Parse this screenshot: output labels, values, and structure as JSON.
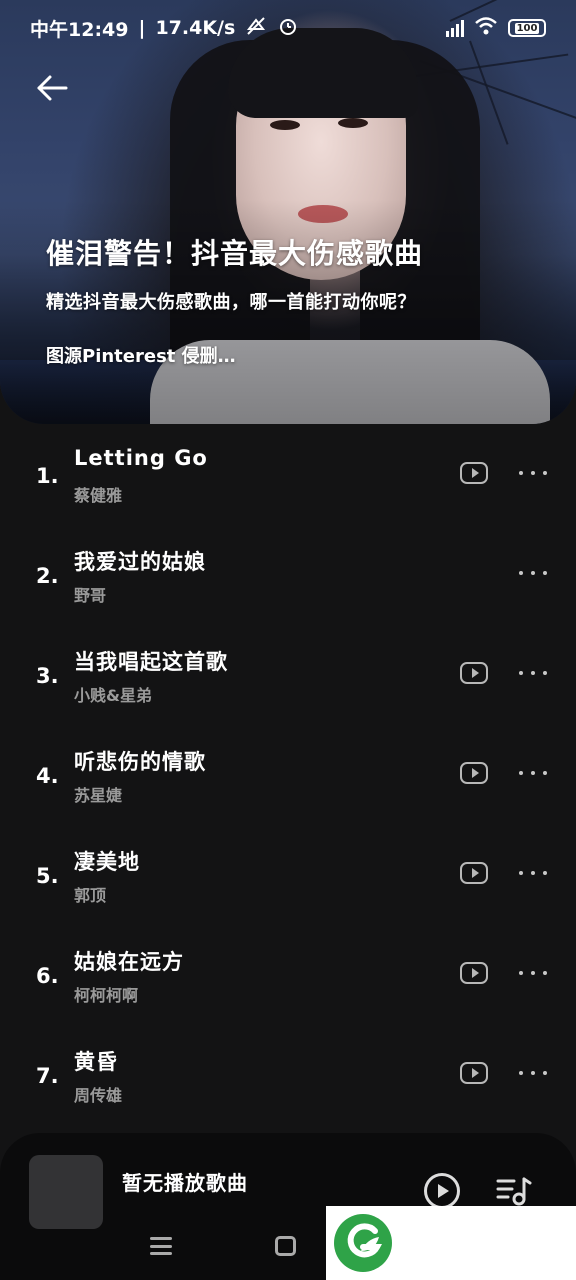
{
  "status_bar": {
    "time": "中午12:49",
    "speed": "17.4K/s",
    "battery": "100"
  },
  "header": {
    "title": "催泪警告！抖音最大伤感歌曲",
    "subtitle": "精选抖音最大伤感歌曲，哪一首能打动你呢？",
    "description": "图源Pinterest 侵删…"
  },
  "songs": [
    {
      "index": "1.",
      "title": "Letting Go",
      "artist": "蔡健雅",
      "has_video": true
    },
    {
      "index": "2.",
      "title": "我爱过的姑娘",
      "artist": "野哥",
      "has_video": false
    },
    {
      "index": "3.",
      "title": "当我唱起这首歌",
      "artist": "小贱&星弟",
      "has_video": true
    },
    {
      "index": "4.",
      "title": "听悲伤的情歌",
      "artist": "苏星婕",
      "has_video": true
    },
    {
      "index": "5.",
      "title": "凄美地",
      "artist": "郭顶",
      "has_video": true
    },
    {
      "index": "6.",
      "title": "姑娘在远方",
      "artist": "柯柯柯啊",
      "has_video": true
    },
    {
      "index": "7.",
      "title": "黄昏",
      "artist": "周传雄",
      "has_video": true
    }
  ],
  "player": {
    "now_playing": "暂无播放歌曲"
  },
  "colors": {
    "background": "#131314",
    "player_bg": "#0b0b0c",
    "artist_text": "#9a9a9a",
    "badge_green": "#2fa348"
  }
}
